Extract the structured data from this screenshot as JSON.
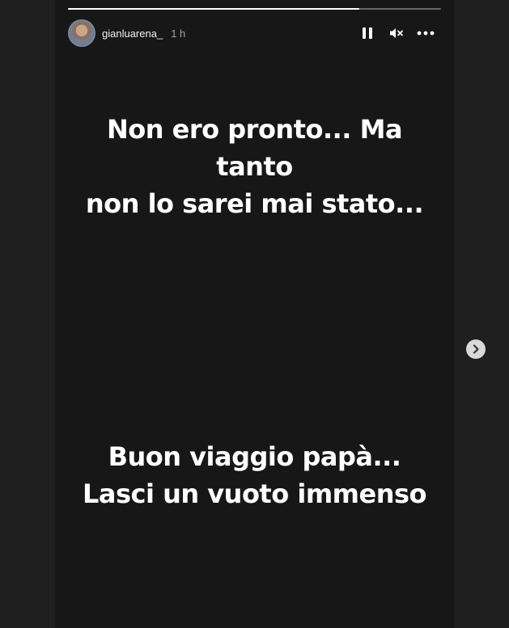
{
  "story": {
    "progress": 0.78,
    "user": {
      "username": "gianluarena_",
      "time": "1 h"
    },
    "controls": {
      "pause_icon": "pause-icon",
      "mute_icon": "speaker-muted-icon",
      "more_icon": "more-options-icon"
    },
    "caption_top": [
      "Non ero pronto... Ma",
      "tanto",
      "non lo sarei mai stato..."
    ],
    "caption_bottom": [
      "Buon viaggio papà...",
      "Lasci un vuoto immenso"
    ]
  },
  "navigation": {
    "next_icon": "chevron-right-icon"
  },
  "colors": {
    "background": "#1f1f1f",
    "story_background": "#171717",
    "text": "#ffffff"
  }
}
